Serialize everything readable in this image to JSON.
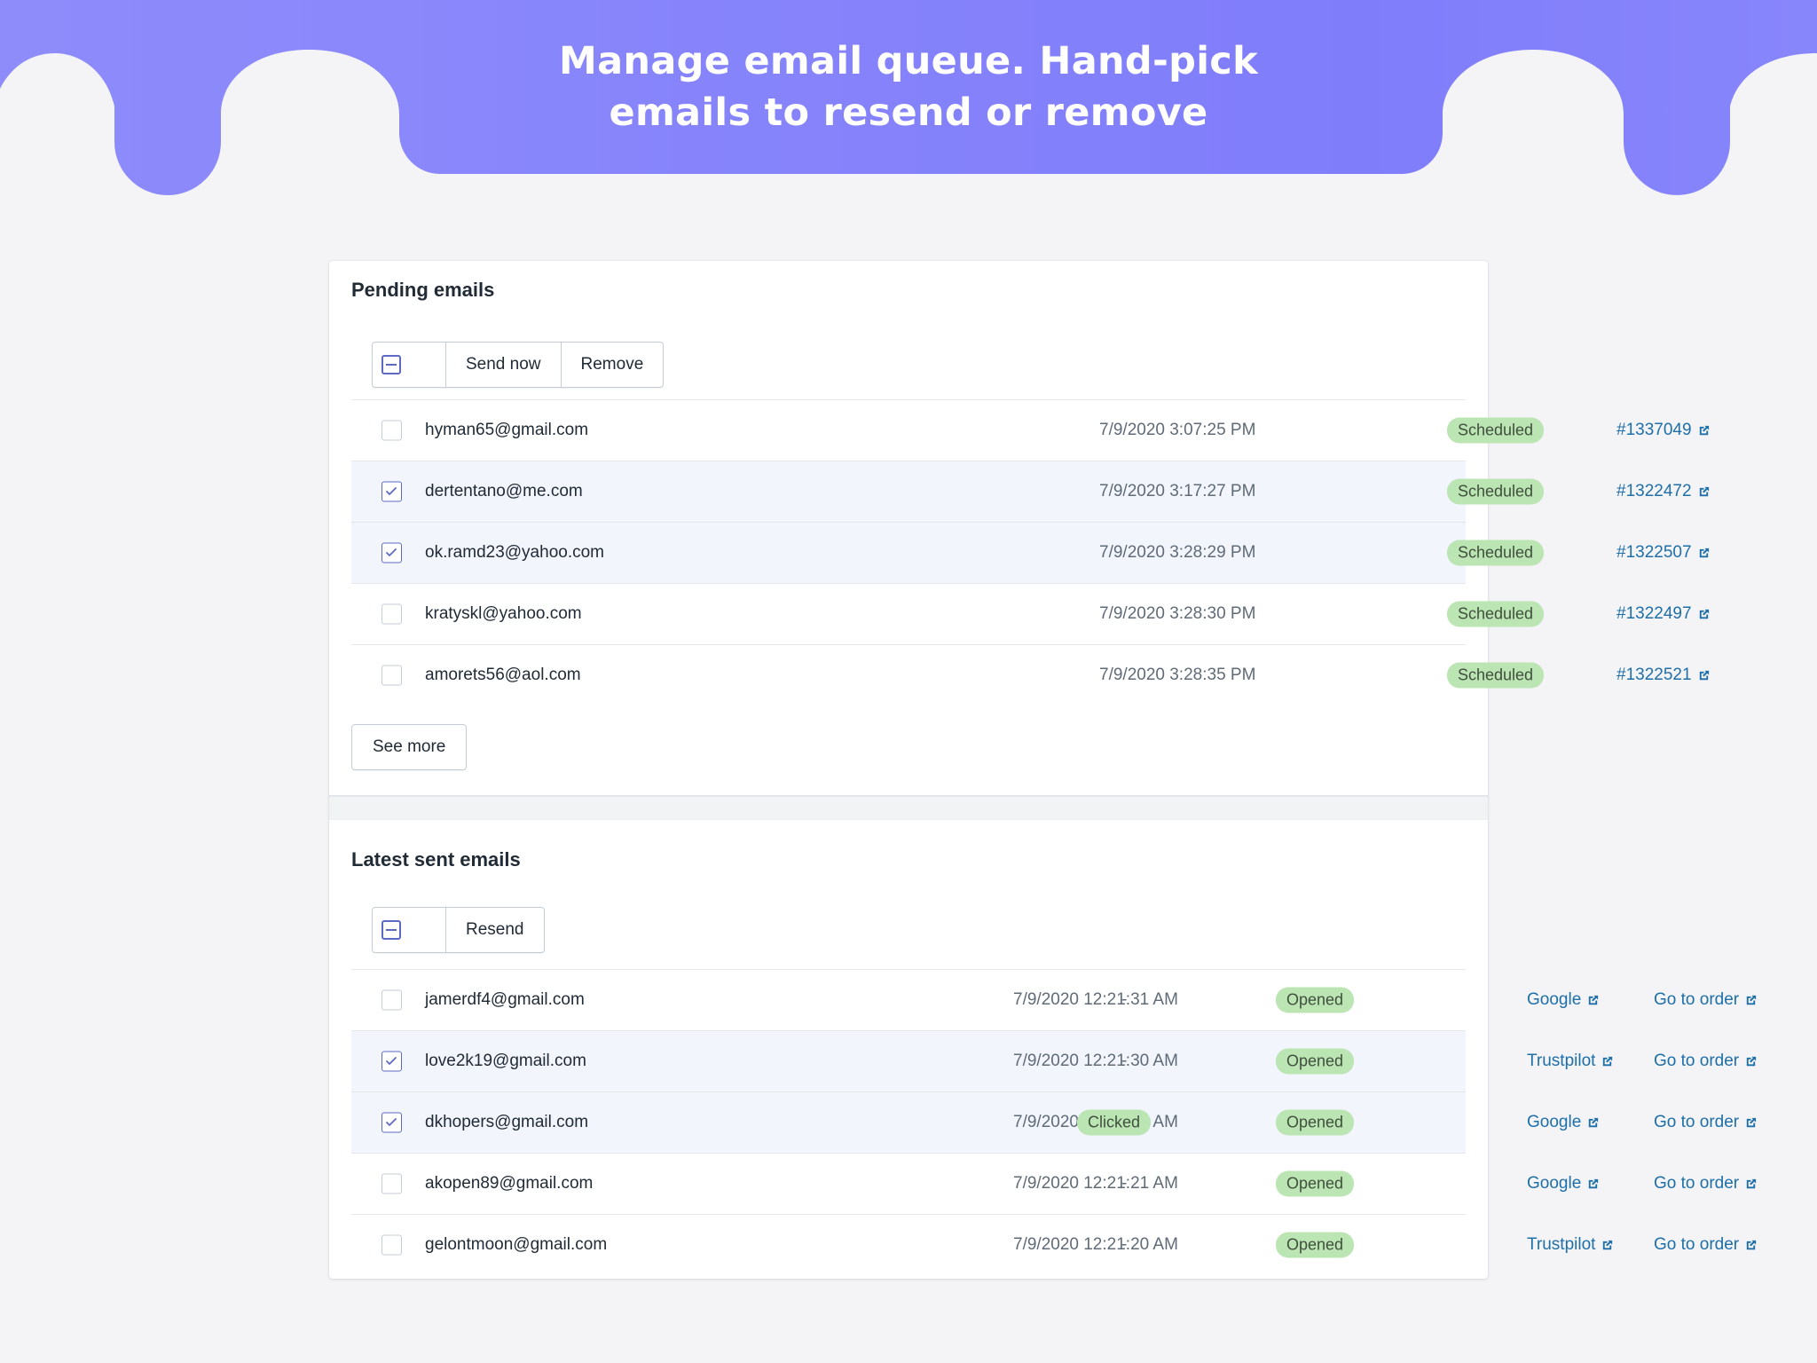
{
  "headline": {
    "line1": "Manage email queue. Hand-pick",
    "line2": "emails to resend or remove"
  },
  "colors": {
    "banner": "#8280fb",
    "accent": "#5c6ac4",
    "badge_bg": "#bbe5b3",
    "link": "#1e6fa8"
  },
  "pending": {
    "title": "Pending emails",
    "actions": {
      "send_now": "Send now",
      "remove": "Remove"
    },
    "rows": [
      {
        "checked": false,
        "email": "hyman65@gmail.com",
        "date": "7/9/2020 3:07:25 PM",
        "status": "Scheduled",
        "order": "#1337049"
      },
      {
        "checked": true,
        "email": "dertentano@me.com",
        "date": "7/9/2020 3:17:27 PM",
        "status": "Scheduled",
        "order": "#1322472"
      },
      {
        "checked": true,
        "email": "ok.ramd23@yahoo.com",
        "date": "7/9/2020 3:28:29 PM",
        "status": "Scheduled",
        "order": "#1322507"
      },
      {
        "checked": false,
        "email": "kratyskl@yahoo.com",
        "date": "7/9/2020 3:28:30 PM",
        "status": "Scheduled",
        "order": "#1322497"
      },
      {
        "checked": false,
        "email": "amorets56@aol.com",
        "date": "7/9/2020 3:28:35 PM",
        "status": "Scheduled",
        "order": "#1322521"
      }
    ],
    "see_more": "See more"
  },
  "sent": {
    "title": "Latest sent emails",
    "actions": {
      "resend": "Resend"
    },
    "rows": [
      {
        "checked": false,
        "email": "jamerdf4@gmail.com",
        "date": "7/9/2020 12:21:31 AM",
        "opened": "Opened",
        "clicked": "-",
        "platform": "Google",
        "order_link": "Go to order"
      },
      {
        "checked": true,
        "email": "love2k19@gmail.com",
        "date": "7/9/2020 12:21:30 AM",
        "opened": "Opened",
        "clicked": "-",
        "platform": "Trustpilot",
        "order_link": "Go to order"
      },
      {
        "checked": true,
        "email": "dkhopers@gmail.com",
        "date": "7/9/2020 12:21:30 AM",
        "opened": "Opened",
        "clicked": "Clicked",
        "platform": "Google",
        "order_link": "Go to order"
      },
      {
        "checked": false,
        "email": "akopen89@gmail.com",
        "date": "7/9/2020 12:21:21 AM",
        "opened": "Opened",
        "clicked": "-",
        "platform": "Google",
        "order_link": "Go to order"
      },
      {
        "checked": false,
        "email": "gelontmoon@gmail.com",
        "date": "7/9/2020 12:21:20 AM",
        "opened": "Opened",
        "clicked": "-",
        "platform": "Trustpilot",
        "order_link": "Go to order"
      }
    ]
  }
}
